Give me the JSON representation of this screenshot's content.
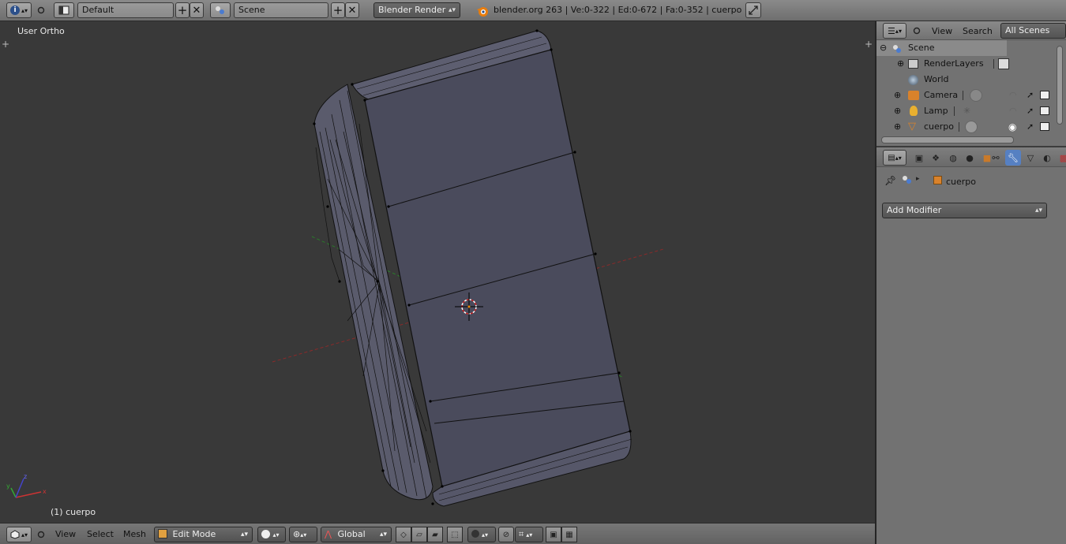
{
  "topbar": {
    "info_icon": "info-icon",
    "layout_name": "Default",
    "scene_name": "Scene",
    "render_engine": "Blender Render",
    "stats": "blender.org 263 | Ve:0-322 | Ed:0-672 | Fa:0-352 | cuerpo"
  },
  "viewport": {
    "view_label": "User Ortho",
    "object_label": "(1) cuerpo"
  },
  "bottombar": {
    "menus": [
      "View",
      "Select",
      "Mesh"
    ],
    "mode": "Edit Mode",
    "orientation": "Global"
  },
  "outliner": {
    "view_menu": "View",
    "search_menu": "Search",
    "filter": "All Scenes",
    "items": [
      {
        "label": "Scene"
      },
      {
        "label": "RenderLayers"
      },
      {
        "label": "World"
      },
      {
        "label": "Camera"
      },
      {
        "label": "Lamp"
      },
      {
        "label": "cuerpo"
      }
    ]
  },
  "properties": {
    "context_object": "cuerpo",
    "add_modifier": "Add Modifier"
  },
  "colors": {
    "mesh_face": "#4a4b5c",
    "mesh_side": "#5d5e70",
    "active_tab": "#5680c2",
    "axis_x": "#8a2a2a",
    "axis_y": "#2a7a2a"
  }
}
